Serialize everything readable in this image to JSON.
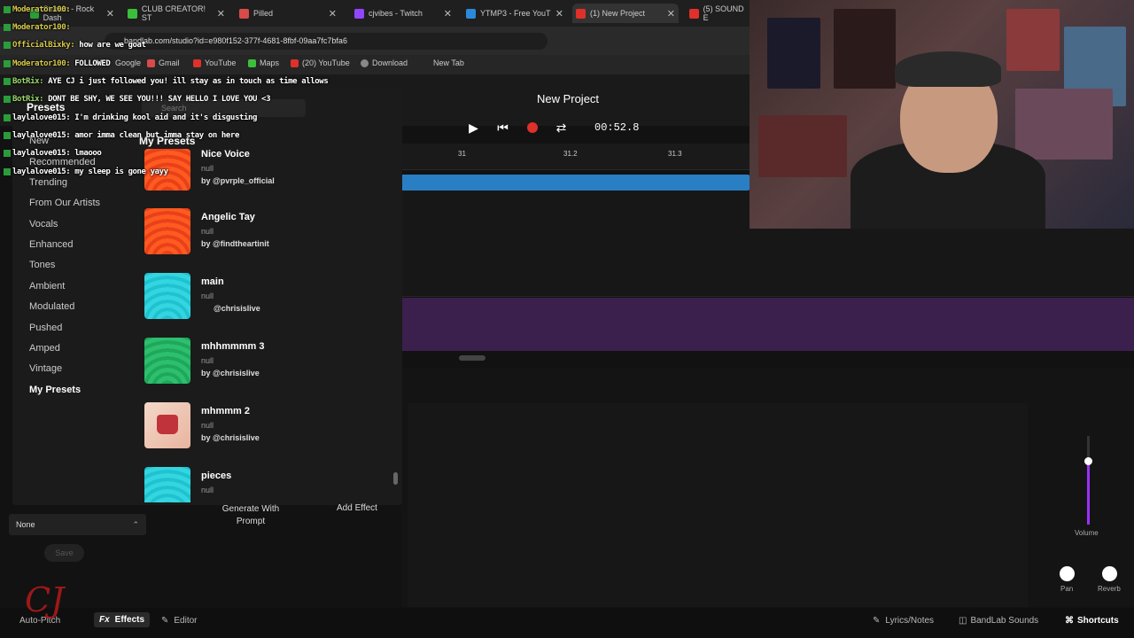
{
  "browser": {
    "tabs": [
      {
        "label": "Stream - Rock Dash",
        "icon_color": "#2a9d3a"
      },
      {
        "label": "CLUB CREATOR! ST",
        "icon_color": "#3bbf3b"
      },
      {
        "label": "Pilled",
        "icon_color": "#d94a4a"
      },
      {
        "label": "cjvibes - Twitch",
        "icon_color": "#9146ff"
      },
      {
        "label": "YTMP3 - Free YouT",
        "icon_color": "#2a8ad9"
      },
      {
        "label": "(1) New Project",
        "icon_color": "#e0302a"
      },
      {
        "label": "(5) SOUND E",
        "icon_color": "#e0302a"
      }
    ],
    "url": "bandlab.com/studio?id=e980f152-377f-4681-8fbf-09aa7fc7bfa6",
    "bookmarks": [
      "Google",
      "Gmail",
      "YouTube",
      "Maps",
      "(20) YouTube",
      "Download",
      "New Tab"
    ]
  },
  "studio": {
    "project_title": "New Project",
    "timecode": "00:52.8",
    "ruler_marks": [
      "31",
      "31.2",
      "31.3"
    ]
  },
  "presets": {
    "title": "Presets",
    "search_placeholder": "Search",
    "heading": "My Presets",
    "categories": [
      "New",
      "Recommended",
      "Trending",
      "From Our Artists",
      "Vocals",
      "Enhanced",
      "Tones",
      "Ambient",
      "Modulated",
      "Pushed",
      "Amped",
      "Vintage",
      "My Presets"
    ],
    "items": [
      {
        "name": "Nice Voice",
        "sub": "null",
        "by": "by @pvrple_official",
        "thumb": "orange"
      },
      {
        "name": "Angelic Tay",
        "sub": "null",
        "by": "by @findtheartinit",
        "thumb": "orange"
      },
      {
        "name": "main",
        "sub": "null",
        "by": "@chrisislive",
        "thumb": "cyan"
      },
      {
        "name": "mhhmmmm 3",
        "sub": "null",
        "by": "by @chrisislive",
        "thumb": "green"
      },
      {
        "name": "mhmmm 2",
        "sub": "null",
        "by": "by @chrisislive",
        "thumb": "cake"
      },
      {
        "name": "pieces",
        "sub": "null",
        "by": "",
        "thumb": "cyan"
      }
    ],
    "generate_label": "Generate With Prompt",
    "add_effect_label": "Add Effect"
  },
  "left_controls": {
    "preset_select": "None",
    "save_label": "Save"
  },
  "mixer": {
    "volume_label": "Volume",
    "volume_level": 0.72,
    "pan_label": "Pan",
    "reverb_label": "Reverb"
  },
  "bottom_bar": {
    "autopitch": "Auto-Pitch",
    "effects": "Effects",
    "editor": "Editor",
    "lyrics": "Lyrics/Notes",
    "sounds": "BandLab Sounds",
    "shortcuts": "Shortcuts"
  },
  "chat": [
    {
      "user": "Moderator100:",
      "msg": ""
    },
    {
      "user": "Moderator100:",
      "msg": ""
    },
    {
      "user": "OfficialBixky:",
      "msg": "how are we goat"
    },
    {
      "user": "Moderator100:",
      "msg": "FOLLOWED"
    },
    {
      "user": "BotRix:",
      "msg": "AYE CJ i just followed you! ill stay as in touch as time allows"
    },
    {
      "user": "BotRix:",
      "msg": "DONT BE SHY, WE SEE YOU!!! SAY HELLO I LOVE YOU <3"
    },
    {
      "user": "laylalove015:",
      "msg": "I'm drinking kool aid and it's disgusting"
    },
    {
      "user": "laylalove015:",
      "msg": "amor imma clean but imma stay on here"
    },
    {
      "user": "laylalove015:",
      "msg": "lmaooo"
    },
    {
      "user": "laylalove015:",
      "msg": "my sleep is gone yayy"
    }
  ]
}
